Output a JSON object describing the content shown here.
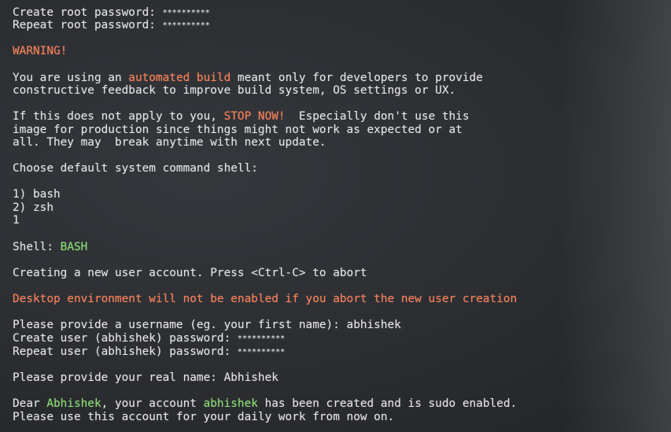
{
  "terminal": {
    "root_password_prompt": "Create root password: ",
    "root_password_masked": "**********",
    "root_repeat_prompt": "Repeat root password: ",
    "root_repeat_masked": "**********",
    "warning_heading": "WARNING!",
    "warning_p1_a": "You are using an ",
    "warning_p1_highlight": "automated build",
    "warning_p1_b": " meant only for developers to provide",
    "warning_p1_c": "constructive feedback to improve build system, OS settings or UX.",
    "warning_p2_a": "If this does not apply to you, ",
    "warning_p2_highlight": "STOP NOW!",
    "warning_p2_b": "  Especially don't use this",
    "warning_p2_c": "image for production since things might not work as expected or at",
    "warning_p2_d": "all. They may  break anytime with next update.",
    "shell_question": "Choose default system command shell:",
    "shell_options": [
      "1) bash",
      "2) zsh"
    ],
    "shell_input": "1",
    "shell_result_label": "Shell: ",
    "shell_result_value": "BASH",
    "creating_user": "Creating a new user account. Press <Ctrl-C> to abort",
    "desktop_warning": "Desktop environment will not be enabled if you abort the new user creation",
    "username_prompt": "Please provide a username (eg. your first name): abhishek",
    "user_password_prompt": "Create user (abhishek) password: ",
    "user_password_masked": "**********",
    "user_repeat_prompt": "Repeat user (abhishek) password: ",
    "user_repeat_masked": "**********",
    "realname_prompt": "Please provide your real name: Abhishek",
    "dear_a": "Dear ",
    "dear_name": "Abhishek",
    "dear_b": ", your account ",
    "dear_user": "abhishek",
    "dear_c": " has been created and is sudo enabled.",
    "daily_use": "Please use this account for your daily work from now on."
  },
  "colors": {
    "highlight_orange": "#ff7a4f",
    "highlight_green": "#86e06d",
    "text": "#e4e4e4",
    "background": "#2b2d31"
  }
}
